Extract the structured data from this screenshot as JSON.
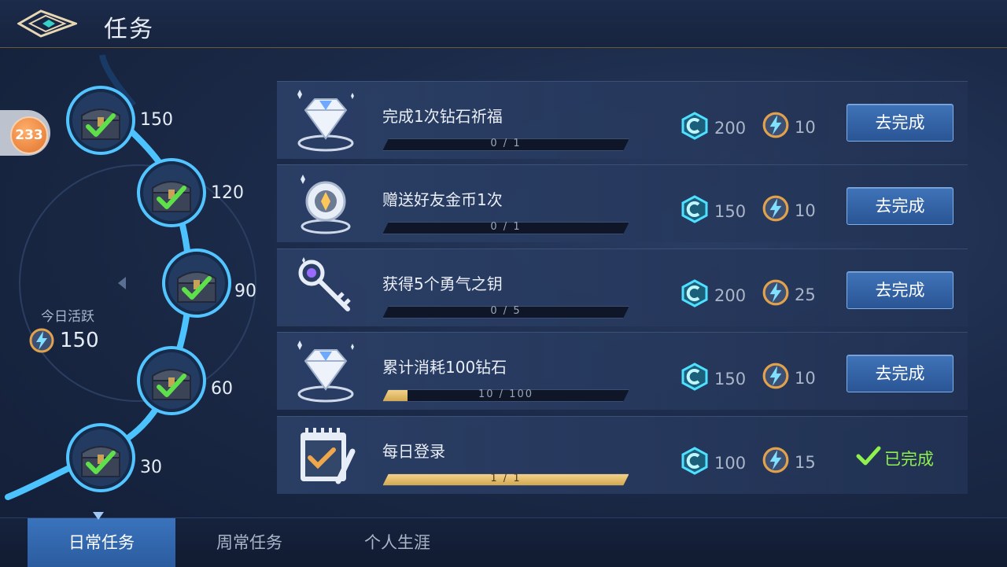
{
  "header": {
    "title": "任务"
  },
  "activity_badge": {
    "value": "233"
  },
  "today": {
    "label": "今日活跃",
    "value": "150"
  },
  "milestones": [
    {
      "value": "150",
      "claimed": true
    },
    {
      "value": "120",
      "claimed": true
    },
    {
      "value": "90",
      "claimed": true
    },
    {
      "value": "60",
      "claimed": true
    },
    {
      "value": "30",
      "claimed": true
    }
  ],
  "tasks": [
    {
      "name": "完成1次钻石祈福",
      "icon": "diamond-icon",
      "progress_text": "0 / 1",
      "progress": 0.0,
      "reward_coupon": "200",
      "reward_activity": "10",
      "action": "去完成",
      "completed": false
    },
    {
      "name": "赠送好友金币1次",
      "icon": "gold-coin-icon",
      "progress_text": "0 / 1",
      "progress": 0.0,
      "reward_coupon": "150",
      "reward_activity": "10",
      "action": "去完成",
      "completed": false
    },
    {
      "name": "获得5个勇气之钥",
      "icon": "key-icon",
      "progress_text": "0 / 5",
      "progress": 0.0,
      "reward_coupon": "200",
      "reward_activity": "25",
      "action": "去完成",
      "completed": false
    },
    {
      "name": "累计消耗100钻石",
      "icon": "diamond-icon",
      "progress_text": "10 / 100",
      "progress": 0.1,
      "reward_coupon": "150",
      "reward_activity": "10",
      "action": "去完成",
      "completed": false
    },
    {
      "name": "每日登录",
      "icon": "calendar-check-icon",
      "progress_text": "1 / 1",
      "progress": 1.0,
      "reward_coupon": "100",
      "reward_activity": "15",
      "action": "已完成",
      "completed": true
    }
  ],
  "tabs": [
    {
      "label": "日常任务",
      "active": true
    },
    {
      "label": "周常任务",
      "active": false
    },
    {
      "label": "个人生涯",
      "active": false
    }
  ],
  "colors": {
    "accent": "#3a73bd",
    "progress": "#d9b15e",
    "done": "#8ff04e",
    "track": "#45b8ff"
  }
}
